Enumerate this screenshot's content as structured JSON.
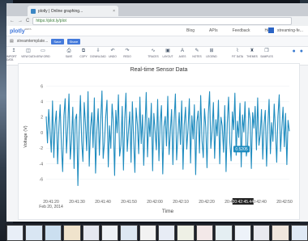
{
  "browser": {
    "tab_title": "plotly | Online graphing...",
    "tab_close": "×",
    "url": "https://plot.ly/plot",
    "nav_back": "←",
    "nav_forward": "→",
    "nav_reload": "C"
  },
  "plotly_nav": {
    "logo": "plotly",
    "logo_sup": "BETA",
    "links": [
      "Blog",
      "APIs",
      "Feedback",
      "Help"
    ],
    "user_name": "streaming-fe..."
  },
  "file_bar": {
    "file_name": "streamtemplate...",
    "button_save": "Save",
    "button_share": "Share"
  },
  "toolbar": {
    "left_tools": [
      {
        "icon": "↥",
        "label": "IMPORT DATA"
      },
      {
        "icon": "◫",
        "label": "VIEW DATA"
      },
      {
        "icon": "▭",
        "label": "VIEW GRID"
      }
    ],
    "mid_tools": [
      {
        "icon": "⎙",
        "label": "SAVE"
      },
      {
        "icon": "⧉",
        "label": "COPY"
      },
      {
        "icon": "⇩",
        "label": "DOWNLOAD"
      },
      {
        "icon": "↶",
        "label": "UNDO"
      },
      {
        "icon": "↷",
        "label": "REDO"
      }
    ],
    "right_tools": [
      {
        "icon": "∿",
        "label": "TRACES"
      },
      {
        "icon": "▣",
        "label": "LAYOUT"
      },
      {
        "icon": "A",
        "label": "AXES"
      },
      {
        "icon": "✎",
        "label": "NOTES"
      },
      {
        "icon": "⊞",
        "label": "LEGEND"
      }
    ],
    "fit_tools": [
      {
        "icon": "⌇",
        "label": "FIT DATA"
      },
      {
        "icon": "♜",
        "label": "THEMES"
      },
      {
        "icon": "❐",
        "label": "SAMPLES"
      }
    ],
    "right_icons": [
      "●",
      "●"
    ]
  },
  "chart_data": {
    "type": "line",
    "title": "Real-time Sensor Data",
    "xlabel": "Time",
    "ylabel": "Voltage (V)",
    "color": "#1f8cbf",
    "x_ticks": [
      "20:41:20\nFeb 20, 2014",
      "20:41:30",
      "20:41:40",
      "20:41:50",
      "20:42:00",
      "20:42:10",
      "20:42:20",
      "20:42:30",
      "20:42:40",
      "20:42:50"
    ],
    "x_highlight": "20:42:45.44",
    "hover_label": "0.5205",
    "y_ticks": [
      "6",
      "4",
      "2",
      "0",
      "-2",
      "-4",
      "-6"
    ],
    "ylim": [
      -8,
      7
    ],
    "values": [
      2.1,
      -1.3,
      3.0,
      0.2,
      -2.5,
      4.1,
      -3.2,
      1.0,
      2.8,
      -4.0,
      0.5,
      3.6,
      -1.8,
      -5.0,
      2.2,
      4.4,
      -2.6,
      0.8,
      5.0,
      -3.4,
      -0.9,
      3.3,
      -4.6,
      1.7,
      2.4,
      -6.8,
      0.1,
      4.8,
      -1.1,
      -3.7,
      3.9,
      1.2,
      -2.3,
      5.3,
      -4.3,
      0.7,
      2.6,
      -1.9,
      4.5,
      -5.2,
      0.3,
      3.1,
      -2.9,
      1.5,
      5.4,
      -3.3,
      -1.2,
      2.0,
      4.2,
      -4.4,
      0.9,
      -2.0,
      3.7,
      1.4,
      -5.5,
      2.9,
      0.0,
      4.9,
      -3.0,
      -1.6,
      3.4,
      -4.8,
      1.8,
      5.1,
      -2.4,
      0.4,
      2.7,
      -3.8,
      4.0,
      -0.7,
      -5.1,
      3.2,
      1.1,
      -2.7,
      4.6,
      -1.4,
      2.3,
      -4.2,
      0.6,
      5.2,
      -3.1,
      1.9,
      -0.5,
      3.8,
      -4.9,
      2.5,
      0.2,
      -2.2,
      4.3,
      -3.6,
      1.3,
      3.5,
      -5.3,
      0.8,
      2.1,
      -1.7,
      4.7,
      -2.8,
      0.0,
      3.0,
      -4.1,
      1.6,
      5.0,
      -3.5,
      -0.3,
      2.6,
      -1.5,
      4.1,
      -4.7,
      1.0,
      3.3,
      -2.1,
      0.5,
      4.4,
      -3.9,
      2.2,
      -0.8,
      3.6,
      -5.4,
      1.4,
      2.8,
      -2.6,
      4.8,
      -1.0,
      -3.2,
      3.1,
      0.7,
      -4.5,
      2.4,
      5.3,
      -2.0,
      0.3,
      3.9,
      -3.3,
      1.7,
      -0.4,
      4.2,
      -4.0,
      2.0,
      0.9,
      -2.5,
      3.5,
      -5.0,
      1.2,
      4.6,
      -1.3,
      -3.6,
      2.7,
      0.4,
      5.1,
      -2.9,
      1.5,
      -0.6,
      3.8,
      -4.4,
      2.3,
      0.1,
      4.0,
      -3.0,
      -1.9,
      3.2,
      1.8,
      -4.6,
      2.6,
      0.6,
      3.4,
      -2.2,
      4.5,
      -1.6,
      -0.2,
      3.0,
      -3.4,
      1.1,
      2.9,
      -4.3,
      0.8,
      4.3,
      -2.7,
      1.3,
      -1.1,
      3.7,
      0.3,
      -3.8,
      2.1,
      4.9,
      -2.4,
      0.5,
      3.3,
      -1.8,
      2.5,
      -4.1,
      1.6,
      0.2
    ]
  },
  "thumbnails": [
    "#e8eef7",
    "#d9e6f3",
    "#cbdff0",
    "#f0e3cc",
    "#e5e8f0",
    "#eef2f7",
    "#dde7f1",
    "#f2f2f2",
    "#e7ecf5",
    "#eef0e5",
    "#f3e8e8",
    "#e4eef2",
    "#edf2f9",
    "#e9e9ef",
    "#f0e6dd",
    "#dfe9f5"
  ]
}
